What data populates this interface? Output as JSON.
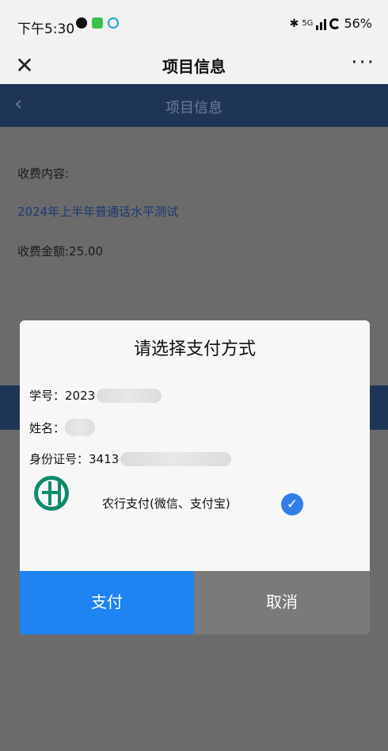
{
  "status_bar": {
    "time": "下午5:30",
    "network": "5G",
    "battery": "56%"
  },
  "top_nav": {
    "close_symbol": "✕",
    "title": "项目信息",
    "more_symbol": "···"
  },
  "page": {
    "header_back": "‹",
    "header_title": "项目信息",
    "fee_content_label": "收费内容:",
    "fee_item": "2024年上半年普通话水平测试",
    "fee_amount": "收费金额:25.00"
  },
  "modal": {
    "title": "请选择支付方式",
    "student_id_label": "学号：",
    "student_id_value": "2023",
    "name_label": "姓名：",
    "id_card_label": "身份证号：",
    "id_card_value": "3413",
    "payment_option": "农行支付(微信、支付宝)",
    "pay_button": "支付",
    "cancel_button": "取消",
    "check_symbol": "✓"
  },
  "colors": {
    "primary_blue": "#1d84f2",
    "check_blue": "#2f7fe6",
    "abc_green": "#0d8a6c",
    "header_navy": "#1f3557"
  }
}
